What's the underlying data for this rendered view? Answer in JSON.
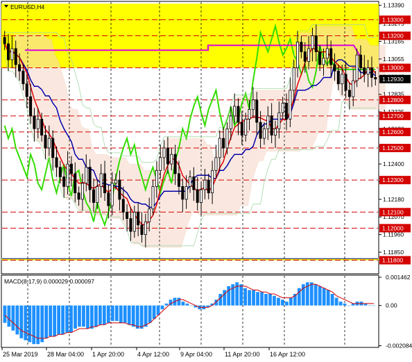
{
  "chart_data": [
    {
      "type": "candlestick",
      "title": "EURUSD,H4",
      "symbol": "EURUSD",
      "timeframe": "H4",
      "ylim": [
        1.1172,
        1.1341
      ],
      "y_ticks": [
        "1.13390",
        "1.13275",
        "1.13165",
        "1.13055",
        "1.12945",
        "1.12835",
        "1.12725",
        "1.12620",
        "1.12510",
        "1.12400",
        "1.12290",
        "1.12180",
        "1.12070",
        "1.11960",
        "1.11850"
      ],
      "x_ticks": [
        "25 Mar 2019",
        "28 Mar 04:00",
        "1 Apr 20:00",
        "4 Apr 12:00",
        "9 Apr 04:00",
        "11 Apr 20:00",
        "16 Apr 12:00"
      ],
      "current_price": "1.12930",
      "levels": [
        {
          "label": "1.13300",
          "value": 1.133
        },
        {
          "label": "1.13200",
          "value": 1.132
        },
        {
          "label": "1.13000",
          "value": 1.13
        },
        {
          "label": "1.12800",
          "value": 1.128
        },
        {
          "label": "1.12700",
          "value": 1.127
        },
        {
          "label": "1.12600",
          "value": 1.126
        },
        {
          "label": "1.12500",
          "value": 1.125
        },
        {
          "label": "1.12300",
          "value": 1.123
        },
        {
          "label": "1.12100",
          "value": 1.121
        },
        {
          "label": "1.12000",
          "value": 1.12
        },
        {
          "label": "1.11800",
          "value": 1.118
        }
      ],
      "zones": [
        {
          "from": 1.13,
          "to": 1.134,
          "color": "#ffff00"
        },
        {
          "from": 1.118,
          "to": 1.1181,
          "color": "#ffff00"
        }
      ],
      "close": [
        1.1315,
        1.1305,
        1.1312,
        1.1302,
        1.1298,
        1.129,
        1.1282,
        1.127,
        1.1262,
        1.1268,
        1.1258,
        1.125,
        1.1256,
        1.1244,
        1.1238,
        1.1232,
        1.1226,
        1.124,
        1.1234,
        1.1222,
        1.1218,
        1.1228,
        1.1238,
        1.1224,
        1.1216,
        1.1226,
        1.1234,
        1.1222,
        1.1214,
        1.1228,
        1.123,
        1.1218,
        1.121,
        1.1206,
        1.1198,
        1.121,
        1.1202,
        1.1196,
        1.1204,
        1.1212,
        1.1226,
        1.1236,
        1.1244,
        1.125,
        1.124,
        1.1246,
        1.1234,
        1.1226,
        1.1218,
        1.1226,
        1.1232,
        1.1224,
        1.1216,
        1.1224,
        1.123,
        1.1222,
        1.1236,
        1.1244,
        1.1256,
        1.125,
        1.1262,
        1.127,
        1.1276,
        1.1266,
        1.1258,
        1.1268,
        1.1274,
        1.128,
        1.1266,
        1.1256,
        1.1262,
        1.127,
        1.1258,
        1.1262,
        1.1272,
        1.1278,
        1.1268,
        1.1286,
        1.13,
        1.1316,
        1.131,
        1.1304,
        1.1312,
        1.132,
        1.131,
        1.1302,
        1.1306,
        1.1312,
        1.1302,
        1.1298,
        1.129,
        1.1296,
        1.1286,
        1.1282,
        1.1292,
        1.1308,
        1.13,
        1.1296,
        1.13,
        1.1294,
        1.1293
      ],
      "indicator_lines": [
        "Ichimoku tenkan (red)",
        "Ichimoku kijun (blue)",
        "Chikou span (green)",
        "Envelope (magenta)"
      ]
    },
    {
      "type": "bar",
      "title": "MACD(8,17,9) 0.000029 0.000097",
      "name": "MACD",
      "params": "8,17,9",
      "value_main": "0.000029",
      "value_signal": "0.000097",
      "ylim": [
        -0.0021,
        0.0015
      ],
      "y_ticks": [
        "0.001462",
        "0.00",
        "-0.002084"
      ],
      "histogram": [
        -0.0009,
        -0.0011,
        -0.0013,
        -0.0015,
        -0.0017,
        -0.0018,
        -0.0019,
        -0.002,
        -0.002,
        -0.0019,
        -0.0017,
        -0.0016,
        -0.0016,
        -0.0015,
        -0.0015,
        -0.0014,
        -0.0014,
        -0.0012,
        -0.0011,
        -0.0011,
        -0.0012,
        -0.0012,
        -0.0011,
        -0.001,
        -0.001,
        -0.0009,
        -0.0008,
        -0.0008,
        -0.0009,
        -0.0009,
        -0.001,
        -0.0011,
        -0.0012,
        -0.0012,
        -0.0011,
        -0.0009,
        -0.0007,
        -0.0005,
        -0.0002,
        0.0001,
        0.0003,
        0.0004,
        0.0004,
        0.0002,
        0.0001,
        0.0,
        -0.0001,
        -0.0002,
        -0.0002,
        -0.0001,
        0.0001,
        0.0003,
        0.0006,
        0.0008,
        0.001,
        0.0011,
        0.0012,
        0.0011,
        0.0009,
        0.0008,
        0.0008,
        0.0007,
        0.0007,
        0.0006,
        0.0006,
        0.0005,
        0.0004,
        0.0003,
        0.0002,
        0.0004,
        0.0006,
        0.0009,
        0.0011,
        0.0012,
        0.0012,
        0.0011,
        0.001,
        0.0009,
        0.0008,
        0.0006,
        0.0004,
        0.0002,
        0.0001,
        0.0,
        0.0001,
        0.0002,
        0.0002,
        0.0001,
        0.0,
        0.0
      ],
      "signal": [
        -0.0005,
        -0.0007,
        -0.0009,
        -0.0011,
        -0.0013,
        -0.0014,
        -0.0015,
        -0.0016,
        -0.0017,
        -0.0017,
        -0.0017,
        -0.0016,
        -0.0016,
        -0.0015,
        -0.0015,
        -0.0014,
        -0.0014,
        -0.0013,
        -0.0012,
        -0.0012,
        -0.0012,
        -0.0011,
        -0.0011,
        -0.001,
        -0.001,
        -0.0009,
        -0.0009,
        -0.0009,
        -0.0009,
        -0.0009,
        -0.001,
        -0.001,
        -0.0011,
        -0.0011,
        -0.001,
        -0.0009,
        -0.0007,
        -0.0005,
        -0.0003,
        -0.0001,
        0.0001,
        0.0002,
        0.0003,
        0.0003,
        0.0002,
        0.0001,
        0.0,
        -0.0001,
        -0.0001,
        -0.0001,
        0.0,
        0.0002,
        0.0004,
        0.0006,
        0.0008,
        0.0009,
        0.001,
        0.001,
        0.001,
        0.0009,
        0.0008,
        0.0008,
        0.0007,
        0.0007,
        0.0006,
        0.0006,
        0.0005,
        0.0004,
        0.0004,
        0.0004,
        0.0005,
        0.0007,
        0.0009,
        0.001,
        0.0011,
        0.0011,
        0.001,
        0.0009,
        0.0008,
        0.0007,
        0.0005,
        0.0004,
        0.0003,
        0.0002,
        0.0001,
        0.0001,
        0.0001,
        0.0001,
        0.0001,
        0.0001
      ]
    }
  ]
}
